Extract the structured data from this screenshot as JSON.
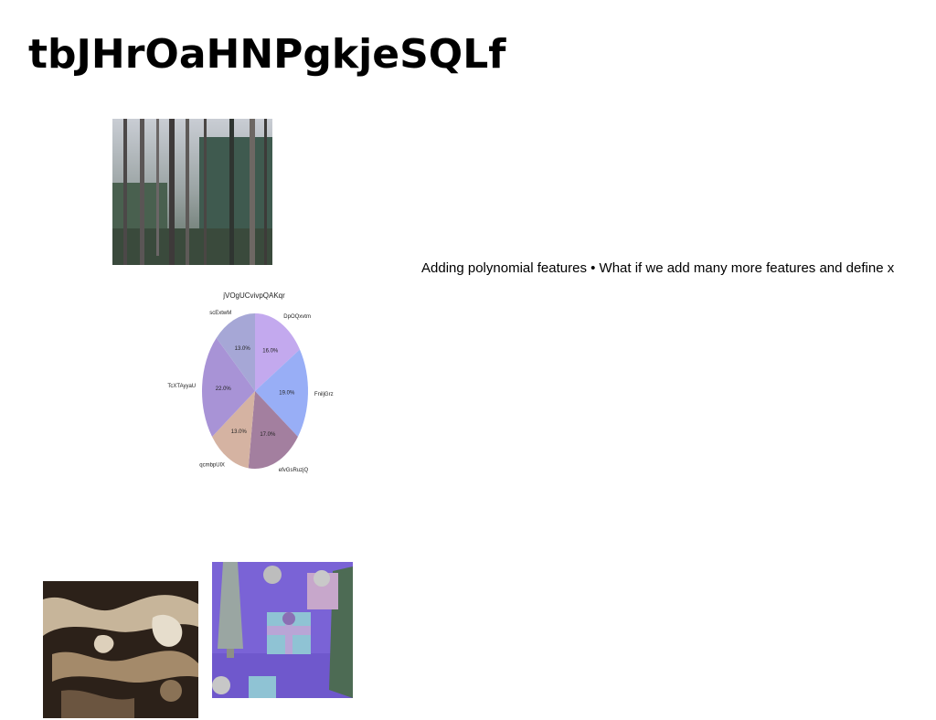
{
  "title": "tbJHrOaHNPgkjeSQLf",
  "caption": "Adding polynomial features • What if we add many more features and define x",
  "images": {
    "forest": "forest-photo",
    "marble": "marble-texture-photo",
    "gifts": "gift-boxes-photo"
  },
  "chart_data": {
    "type": "pie",
    "title": "jVOgUCvivpQAKqr",
    "categories": [
      "DpOQxvtm",
      "FniljGrz",
      "efvGsRuzjQ",
      "qcmbpUlX",
      "TcXTAyyaU",
      "scExtwM"
    ],
    "values": [
      16.0,
      19.0,
      17.0,
      13.0,
      22.0,
      13.0
    ],
    "value_labels": [
      "16.0%",
      "19.0%",
      "17.0%",
      "13.0%",
      "22.0%",
      "13.0%"
    ],
    "colors": [
      "#c3a9ee",
      "#98aef6",
      "#a37f9f",
      "#d5b3a2",
      "#a893d6",
      "#a6a7d6"
    ],
    "start": "12 o'clock, clockwise"
  }
}
